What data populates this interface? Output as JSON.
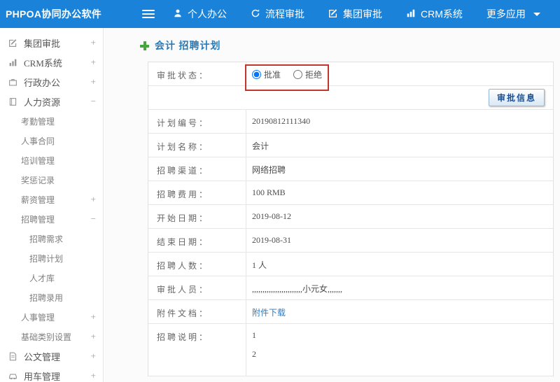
{
  "colors": {
    "topbar": "#1a82d9",
    "annotation": "#c2352b",
    "link": "#2e7cc3",
    "plus": "#46a73c"
  },
  "topbar": {
    "logo": "PHPOA协同办公软件",
    "nav": [
      {
        "label": "个人办公",
        "icon": "person-icon"
      },
      {
        "label": "流程审批",
        "icon": "process-approval-icon"
      },
      {
        "label": "集团审批",
        "icon": "edit-square-icon"
      },
      {
        "label": "CRM系统",
        "icon": "bar-chart-icon"
      },
      {
        "label": "更多应用",
        "icon": "caret-down-icon"
      }
    ]
  },
  "sidebar": {
    "items": [
      {
        "label": "集团审批",
        "toggle": "+",
        "level": 0,
        "icon": "edit-square-icon"
      },
      {
        "label": "CRM系统",
        "toggle": "+",
        "level": 0,
        "icon": "bar-chart-icon"
      },
      {
        "label": "行政办公",
        "toggle": "+",
        "level": 0,
        "icon": "briefcase-icon"
      },
      {
        "label": "人力资源",
        "toggle": "−",
        "level": 0,
        "icon": "book-icon"
      },
      {
        "label": "考勤管理",
        "toggle": "",
        "level": 1
      },
      {
        "label": "人事合同",
        "toggle": "",
        "level": 1
      },
      {
        "label": "培训管理",
        "toggle": "",
        "level": 1
      },
      {
        "label": "奖惩记录",
        "toggle": "",
        "level": 1
      },
      {
        "label": "薪资管理",
        "toggle": "+",
        "level": 1
      },
      {
        "label": "招聘管理",
        "toggle": "−",
        "level": 1
      },
      {
        "label": "招聘需求",
        "toggle": "",
        "level": 2
      },
      {
        "label": "招聘计划",
        "toggle": "",
        "level": 2
      },
      {
        "label": "人才库",
        "toggle": "",
        "level": 2
      },
      {
        "label": "招聘录用",
        "toggle": "",
        "level": 2
      },
      {
        "label": "人事管理",
        "toggle": "+",
        "level": 1
      },
      {
        "label": "基础类别设置",
        "toggle": "+",
        "level": 1
      },
      {
        "label": "公文管理",
        "toggle": "+",
        "level": 0,
        "icon": "document-icon"
      },
      {
        "label": "用车管理",
        "toggle": "+",
        "level": 0,
        "icon": "car-icon"
      }
    ]
  },
  "main": {
    "breadcrumb": "会计 招聘计划",
    "status": {
      "label": "审批状态：",
      "approve": "批准",
      "reject": "拒绝"
    },
    "button": "审批信息",
    "rows": [
      {
        "label": "计划编号：",
        "value": "20190812111340"
      },
      {
        "label": "计划名称：",
        "value": "会计"
      },
      {
        "label": "招聘渠道：",
        "value": "网络招聘"
      },
      {
        "label": "招聘费用：",
        "value": "100 RMB"
      },
      {
        "label": "开始日期：",
        "value": "2019-08-12"
      },
      {
        "label": "结束日期：",
        "value": "2019-08-31"
      },
      {
        "label": "招聘人数：",
        "value": "1 人"
      },
      {
        "label": "审批人员：",
        "value": ",,,,,,,,,,,,,,,,,,,,,,,,小元女,,,,,,,"
      },
      {
        "label": "附件文档：",
        "value": "附件下载"
      }
    ],
    "note": {
      "label": "招聘说明：",
      "line1": "1",
      "line2": "2"
    }
  }
}
